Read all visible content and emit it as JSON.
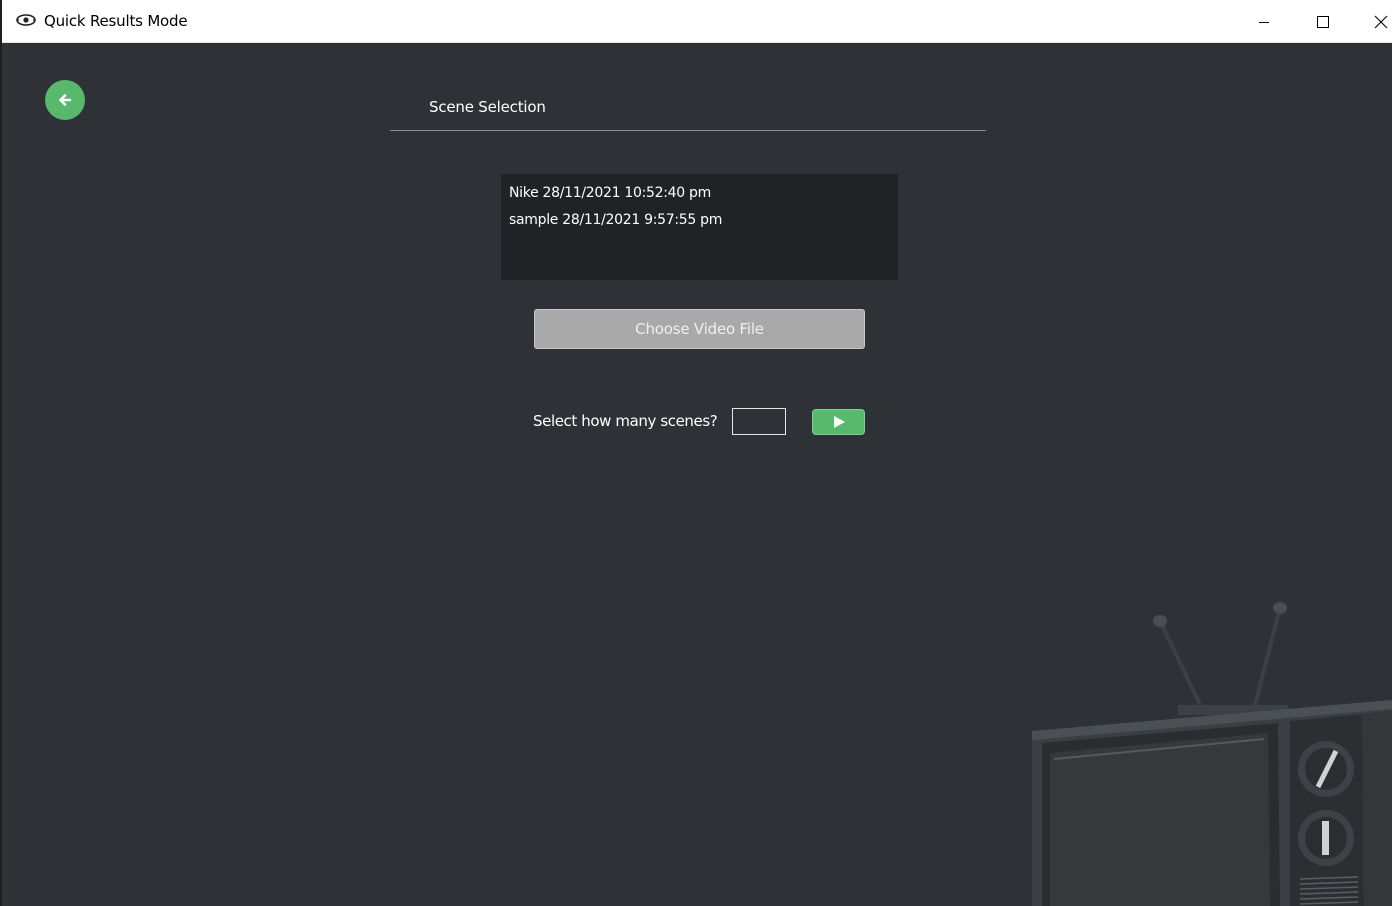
{
  "window": {
    "title": "Quick Results Mode",
    "app_icon": "eye-icon",
    "controls": [
      "minimize-icon",
      "maximize-icon",
      "close-icon"
    ]
  },
  "header": {
    "back_icon": "arrow-left-icon",
    "section_title": "Scene Selection"
  },
  "scene_list": {
    "items": [
      "Nike 28/11/2021 10:52:40 pm",
      "sample 28/11/2021 9:57:55 pm"
    ]
  },
  "choose_button": {
    "label": "Choose Video File"
  },
  "scene_count": {
    "label": "Select how many scenes?",
    "value": "",
    "go_icon": "play-icon"
  },
  "decoration": {
    "illustration": "retro-tv-illustration"
  },
  "colors": {
    "background": "#2e3236",
    "accent_green": "#58b86c",
    "list_background": "#202326",
    "disabled_button": "#a9a9a9"
  }
}
